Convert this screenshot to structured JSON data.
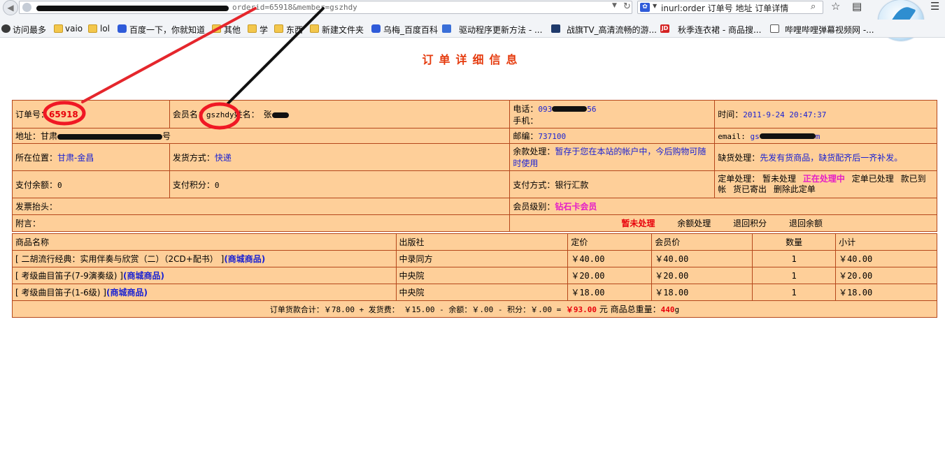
{
  "browser": {
    "url_suffix": "orderid=65918&member=gszhdy",
    "search_text": "inurl:order 订单号 地址 订单详情",
    "bookmarks": [
      "访问最多",
      "vaio",
      "lol",
      "百度一下，你就知道",
      "其他",
      "学",
      "东西",
      "新建文件夹",
      "乌梅_百度百科",
      "驱动程序更新方法 - ...",
      "战旗TV_高清流畅的游...",
      "秋季连衣裙 - 商品搜...",
      "哔哩哔哩弹幕视频网 -..."
    ],
    "jd_icon_text": "JD"
  },
  "page_title": "订单详细信息",
  "order": {
    "number_label": "订单号：",
    "number": "65918",
    "member_label": "会员名：",
    "member": "gszhdy",
    "name_label": "姓名：",
    "name": "张",
    "phone_label": "电话：",
    "phone_visible_prefix": "093",
    "phone_visible_suffix": "56",
    "mobile_label": "手机：",
    "time_label": "时间：",
    "time": "2011-9-24 20:47:37",
    "address_label": "地址：",
    "address_prefix": "甘肃",
    "address_suffix": "号",
    "zip_label": "邮编：",
    "zip": "737100",
    "email_label": "email: ",
    "email_prefix": "gs",
    "email_suffix": "m",
    "location_label": "所在位置：",
    "location": "甘肃-金昌",
    "shipping_label": "发货方式：",
    "shipping": "快递",
    "balance_label": "余款处理：",
    "balance": "暂存于您在本站的帐户中，今后购物可随时使用",
    "shortage_label": "缺货处理：",
    "shortage": "先发有货商品，缺货配齐后一齐补发。",
    "paid_label": "支付余额：",
    "paid": "0",
    "points_label": "支付积分：",
    "points": "0",
    "pay_method_label": "支付方式：",
    "pay_method": "银行汇款",
    "status_label": "定单处理：",
    "status_options": [
      "暂未处理",
      "正在处理中",
      "定单已处理",
      "款已到帐",
      "货已寄出",
      "删除此定单"
    ],
    "status_current": "正在处理中",
    "invoice_label": "发票抬头：",
    "level_label": "会员级别：",
    "level": "钻石卡会员",
    "note_label": "附言：",
    "actions": [
      "暂未处理",
      "余额处理",
      "退回积分",
      "退回余额"
    ],
    "actions_current": "暂未处理"
  },
  "items": {
    "headers": [
      "商品名称",
      "出版社",
      "定价",
      "会员价",
      "数量",
      "小计"
    ],
    "rows": [
      {
        "name": "[ 二胡流行经典：实用伴奏与欣赏（二）（2CD+配书） ]",
        "tag": "(商城商品)",
        "publisher": "中录同方",
        "price": "￥40.00",
        "member_price": "￥40.00",
        "qty": "1",
        "subtotal": "￥40.00"
      },
      {
        "name": "[ 考级曲目笛子(7-9演奏级) ]",
        "tag": "(商城商品)",
        "publisher": "中央院",
        "price": "￥20.00",
        "member_price": "￥20.00",
        "qty": "1",
        "subtotal": "￥20.00"
      },
      {
        "name": "[ 考级曲目笛子(1-6级) ]",
        "tag": "(商城商品)",
        "publisher": "中央院",
        "price": "￥18.00",
        "member_price": "￥18.00",
        "qty": "1",
        "subtotal": "￥18.00"
      }
    ],
    "summary_prefix": "订单货款合计：￥78.00 + 发货费： ￥15.00 - 余额：￥.00 - 积分：￥.00 = ",
    "summary_total": "￥93.00",
    "summary_unit": " 元 商品总重量：",
    "summary_weight": "440",
    "summary_weight_unit": "g"
  },
  "colors": {
    "table_bg": "#fecf99",
    "border": "#b5471b",
    "title": "#e53a0d",
    "highlight_red": "#e8000b",
    "highlight_magenta": "#e51ec7",
    "link_blue": "#1a22d3"
  }
}
